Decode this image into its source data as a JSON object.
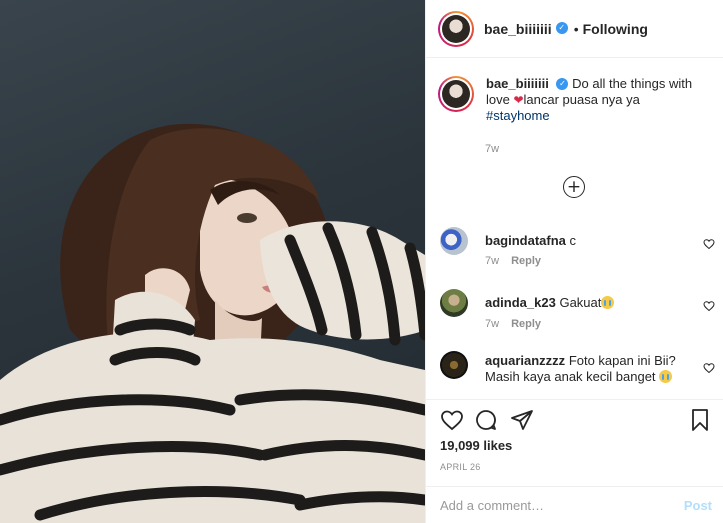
{
  "header": {
    "username": "bae_biiiiiii",
    "verified": true,
    "separator": "•",
    "follow_status": "Following"
  },
  "caption": {
    "username": "bae_biiiiiii",
    "text_before_emoji": "Do all the things with love ",
    "emoji": "heart-emoji",
    "text_after_emoji": "lancar puasa nya ya",
    "hashtag": "#stayhome",
    "time": "7w"
  },
  "load_more_symbol": "+",
  "comments": [
    {
      "username": "bagindatafna",
      "text": "c",
      "time": "7w",
      "reply_label": "Reply"
    },
    {
      "username": "adinda_k23",
      "text": "Gakuat",
      "emoji": "crying-face-emoji",
      "time": "7w",
      "reply_label": "Reply"
    },
    {
      "username": "aquarianzzzz",
      "text": "Foto kapan ini Bii? Masih kaya anak kecil banget",
      "emoji": "crying-face-emoji"
    }
  ],
  "stats": {
    "likes": "19,099 likes",
    "date": "APRIL 26"
  },
  "add_comment": {
    "placeholder": "Add a comment…",
    "post_label": "Post"
  },
  "icons": [
    "heart-icon",
    "comment-icon",
    "share-icon",
    "bookmark-icon",
    "verified-badge-icon",
    "add-circle-icon"
  ],
  "colors": {
    "link": "#003569",
    "verified": "#3897f0",
    "post_button_disabled": "#b2dffc",
    "muted": "#8e8e8e"
  }
}
